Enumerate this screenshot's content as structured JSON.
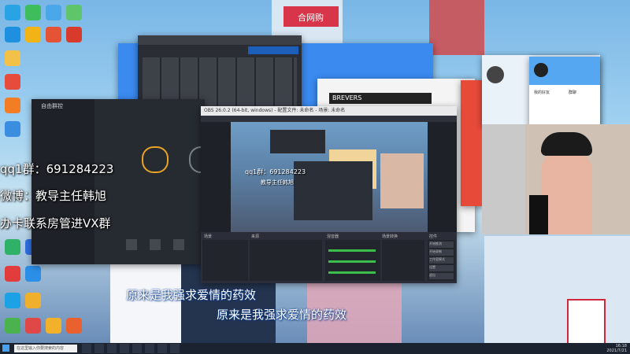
{
  "overlay": {
    "qq_group": "qq1群：691284223",
    "weibo": "微博：教导主任韩旭",
    "vx_group": "办卡联系房管进VX群"
  },
  "lyrics": {
    "line1": "原来是我强求爱情的药效",
    "line2": "原来是我强求爱情的药效"
  },
  "desktop_icons": [
    "app",
    "app",
    "app",
    "app",
    "app",
    "app",
    "app",
    "app",
    "app",
    "app",
    "app",
    "app",
    "app",
    "app",
    "app",
    "app",
    "app",
    "app"
  ],
  "windows": {
    "obs_title": "OBS 26.0.2 (64-bit, windows) - 配置文件: 未命名 - 场景: 未命名",
    "obs_panels": [
      "场景",
      "来源",
      "混音器",
      "场景转换",
      "控件"
    ],
    "obs_controls": [
      "开始推流",
      "开始录制",
      "工作室模式",
      "设置",
      "退出"
    ],
    "obs_preview_qq": "qq1群：691284223",
    "obs_preview_weibo": "教导主任韩旭",
    "brand_left": "自由群控",
    "brand_window": "BREVERS",
    "store_sign": "合网购",
    "qq_panel_tabs": [
      "我的好友",
      "群聊"
    ]
  },
  "taskbar": {
    "search_placeholder": "在这里输入你要搜索的内容",
    "clock_time": "16:18",
    "clock_date": "2021/7/21"
  },
  "colors": {
    "accent_blue": "#1e8fff",
    "obs_dark": "#2b2e38",
    "taskbar": "#1c2330"
  }
}
